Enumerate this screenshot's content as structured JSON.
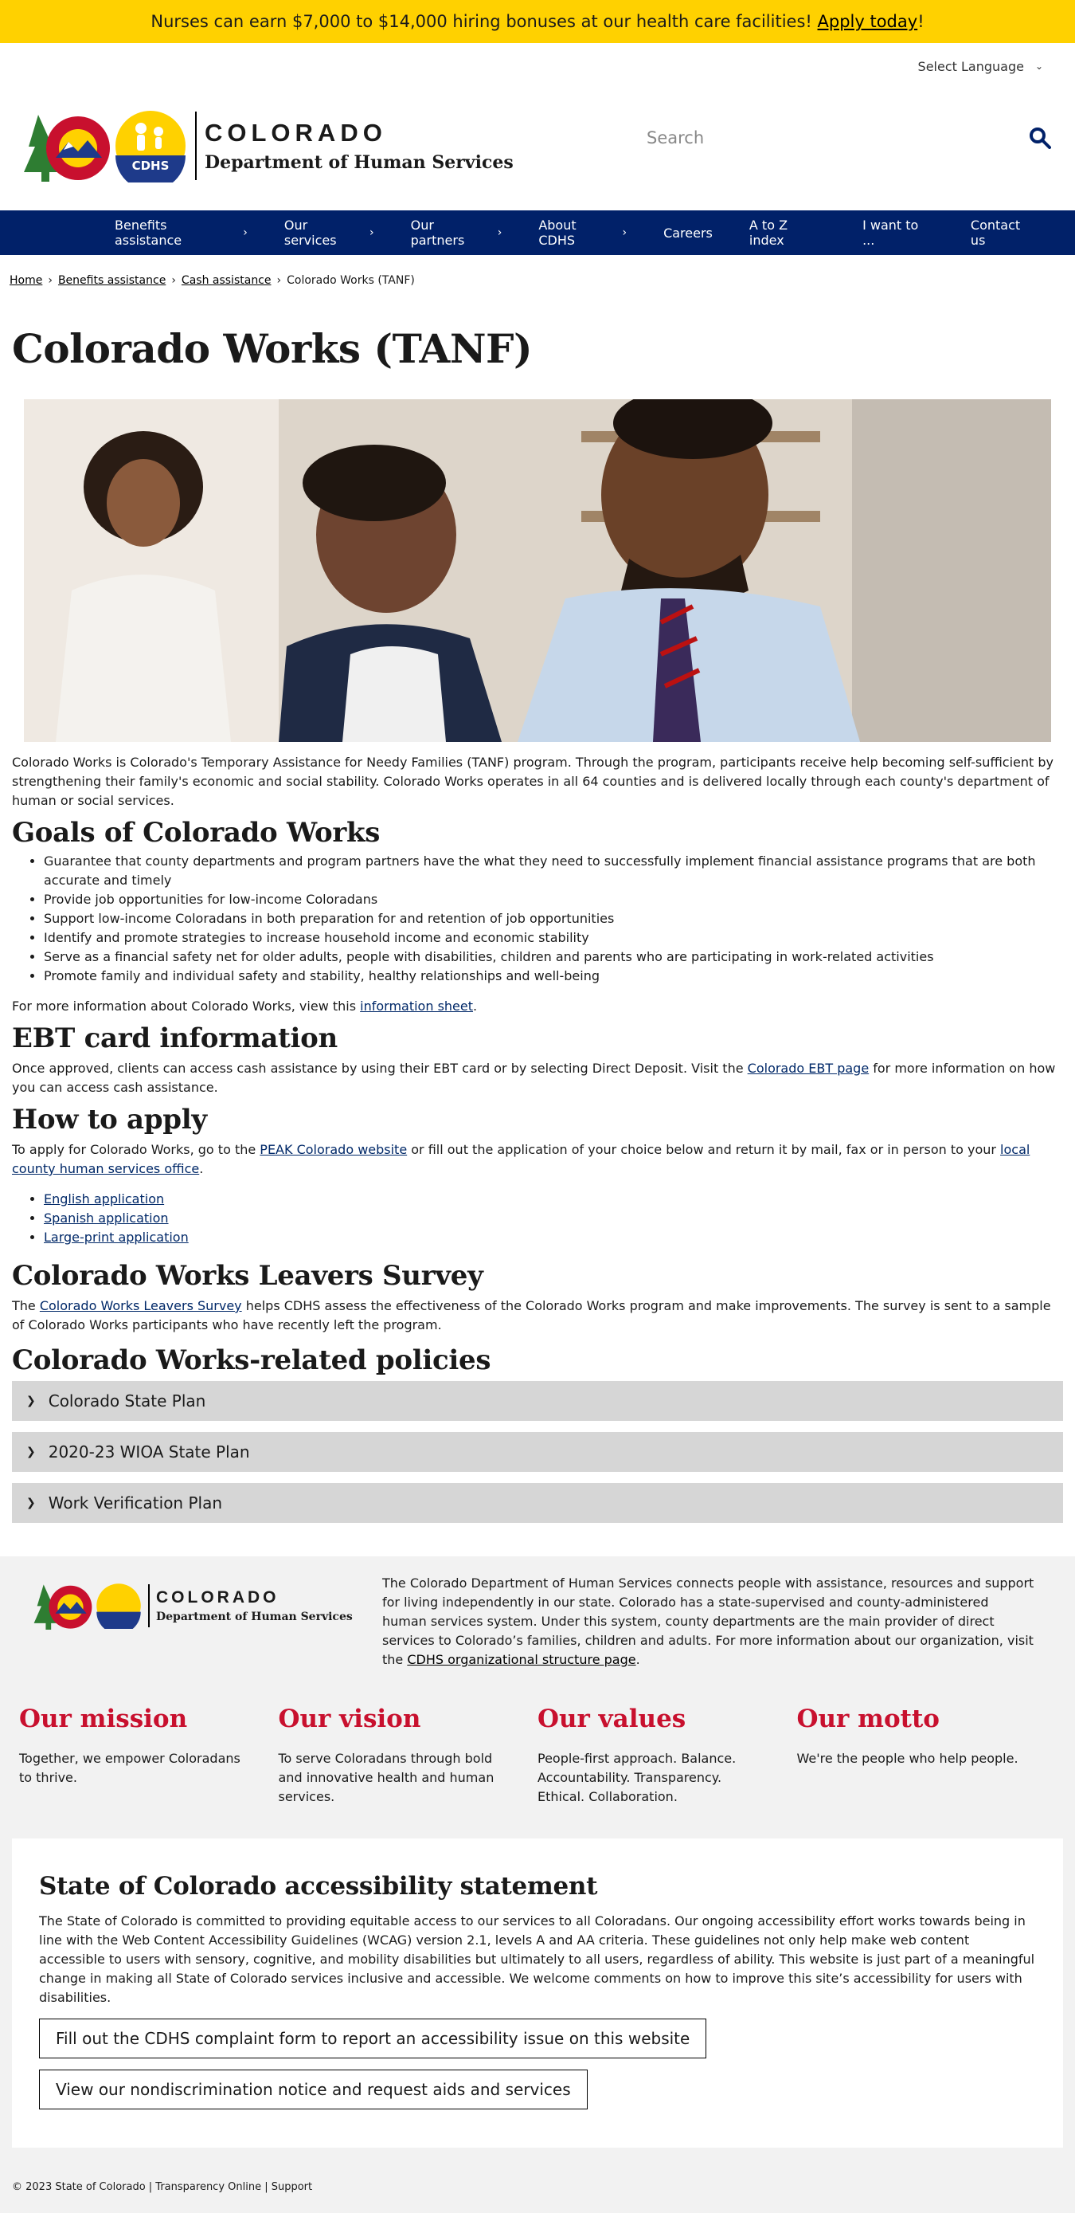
{
  "alert": {
    "text": "Nurses can earn $7,000 to $14,000 hiring bonuses at our health care facilities! ",
    "link": "Apply today",
    "suffix": "!"
  },
  "language": {
    "label": "Select Language"
  },
  "logo": {
    "title": "COLORADO",
    "subtitle": "Department of Human Services",
    "badge": "CDHS"
  },
  "search": {
    "placeholder": "Search"
  },
  "nav": [
    {
      "label": "Benefits assistance",
      "arrow": "›"
    },
    {
      "label": "Our services",
      "arrow": "›"
    },
    {
      "label": "Our partners",
      "arrow": "›"
    },
    {
      "label": "About CDHS",
      "arrow": "›"
    },
    {
      "label": "Careers",
      "arrow": ""
    },
    {
      "label": "A to Z index",
      "arrow": ""
    },
    {
      "label": "I want to ...",
      "arrow": ""
    },
    {
      "label": "Contact us",
      "arrow": ""
    }
  ],
  "breadcrumb": [
    "Home",
    "Benefits assistance",
    "Cash assistance",
    "Colorado Works (TANF)"
  ],
  "page_title": "Colorado Works (TANF)",
  "intro": "Colorado Works is Colorado's Temporary Assistance for Needy Families (TANF) program. Through the program, participants receive help becoming self-sufficient by strengthening their family's economic and social stability. Colorado Works operates in all 64 counties and is delivered locally through each county's department of human or social services.",
  "goals": {
    "heading": "Goals of Colorado Works",
    "items": [
      "Guarantee that county departments and program partners have the what they need to successfully implement financial assistance programs that are both accurate and timely",
      "Provide job opportunities for low-income Coloradans",
      "Support low-income Coloradans in both preparation for and retention of job opportunities",
      "Identify and promote strategies to increase household income and economic stability",
      "Serve as a financial safety net for older adults, people with disabilities, children and parents who are participating in work-related activities",
      "Promote family and individual safety and stability, healthy relationships and well-being"
    ],
    "more_prefix": "For more information about Colorado Works, view this ",
    "more_link": "information sheet",
    "more_suffix": "."
  },
  "ebt": {
    "heading": "EBT card information",
    "text_prefix": "Once approved, clients can access cash assistance by using their EBT card or by selecting Direct Deposit. Visit the ",
    "link": "Colorado EBT page",
    "text_suffix": " for more information on how you can access cash assistance."
  },
  "apply": {
    "heading": "How to apply",
    "p1": "To apply for Colorado Works, go to the ",
    "link1": "PEAK Colorado website",
    "p2": " or fill out the application of your choice below and return it by mail, fax or in person to your ",
    "link2": "local county human services office",
    "p3": ".",
    "apps": [
      "English application",
      "Spanish application",
      "Large-print application"
    ]
  },
  "survey": {
    "heading": "Colorado Works Leavers Survey",
    "prefix": "The ",
    "link": "Colorado Works Leavers Survey",
    "suffix": " helps CDHS assess the effectiveness of the Colorado Works program and make improvements. The survey is sent to a sample of Colorado Works participants who have recently left the program."
  },
  "policies": {
    "heading": "Colorado Works-related policies",
    "items": [
      "Colorado State Plan",
      "2020-23 WIOA State Plan",
      "Work Verification Plan"
    ]
  },
  "footer": {
    "desc_prefix": "The Colorado Department of Human Services connects people with assistance, resources and support for living independently in our state. Colorado has a state-supervised and county-administered human services system. Under this system, county departments are the main provider of direct services to Colorado’s families, children and adults. For more information about our organization, visit the ",
    "desc_link": "CDHS organizational structure page",
    "desc_suffix": ".",
    "mvv": [
      {
        "title": "Our mission",
        "text": "Together, we empower Coloradans to thrive."
      },
      {
        "title": "Our vision",
        "text": "To serve Coloradans through bold and innovative health and human services."
      },
      {
        "title": "Our values",
        "text": "People-first approach. Balance. Accountability. Transparency. Ethical. Collaboration."
      },
      {
        "title": "Our motto",
        "text": "We're the people who help people."
      }
    ]
  },
  "accessibility": {
    "heading": "State of Colorado accessibility statement",
    "text": "The State of Colorado is committed to providing equitable access to our services to all Coloradans. Our ongoing accessibility effort works towards being in line with the Web Content Accessibility Guidelines (WCAG) version 2.1, levels A and AA criteria. These guidelines not only help make web content accessible to users with sensory, cognitive, and mobility disabilities but ultimately to all users, regardless of ability. This website is just part of a meaningful change in making all State of Colorado services inclusive and accessible. We welcome comments on how to improve this site’s accessibility for users with disabilities.",
    "btn1": "Fill out the CDHS complaint form to report an accessibility issue on this website",
    "btn2": "View our nondiscrimination notice and request aids and services"
  },
  "bottom": {
    "text": "© 2023 State of Colorado | Transparency Online | Support"
  },
  "colors": {
    "alert": "#ffd100",
    "nav": "#012169",
    "accent": "#c8102e",
    "link": "#002868"
  }
}
